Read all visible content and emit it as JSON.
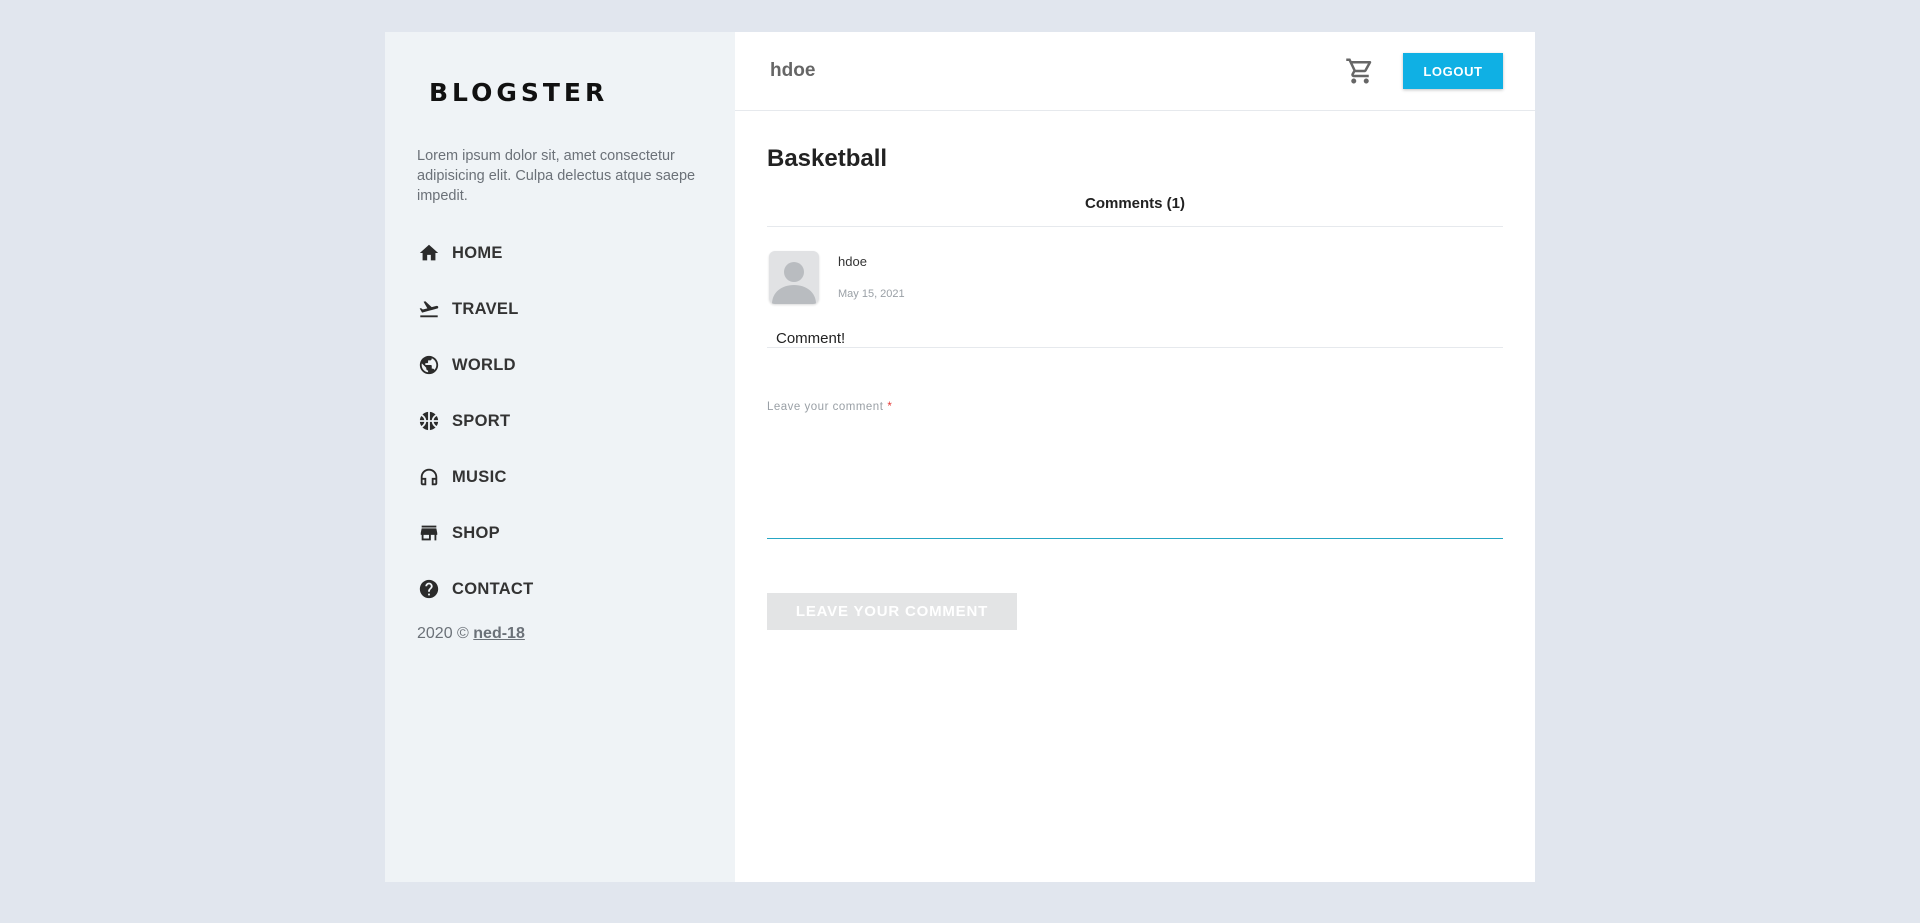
{
  "sidebar": {
    "logo": "BLOGSTER",
    "description": "Lorem ipsum dolor sit, amet consectetur adipisicing elit. Culpa delectus atque saepe impedit.",
    "nav": [
      {
        "label": "HOME",
        "icon": "home-icon"
      },
      {
        "label": "TRAVEL",
        "icon": "flight-takeoff-icon"
      },
      {
        "label": "WORLD",
        "icon": "globe-icon"
      },
      {
        "label": "SPORT",
        "icon": "basketball-icon"
      },
      {
        "label": "MUSIC",
        "icon": "headphones-icon"
      },
      {
        "label": "SHOP",
        "icon": "store-icon"
      },
      {
        "label": "CONTACT",
        "icon": "help-icon"
      }
    ],
    "copyright": "2020 ©",
    "copyright_link": "ned-18"
  },
  "header": {
    "username": "hdoe",
    "cart_icon": "shopping-cart-icon",
    "logout_label": "LOGOUT"
  },
  "post": {
    "title": "Basketball",
    "comments_heading": "Comments (1)",
    "comments": [
      {
        "author": "hdoe",
        "date": "May 15, 2021",
        "text": "Comment!"
      }
    ]
  },
  "form": {
    "label": "Leave your comment",
    "required_mark": "*",
    "value": "",
    "submit_label": "LEAVE YOUR COMMENT"
  },
  "colors": {
    "accent": "#0fb0e4",
    "page_bg": "#e1e6ee",
    "sidebar_bg": "#eff3f6",
    "underline": "#26a6c4"
  }
}
